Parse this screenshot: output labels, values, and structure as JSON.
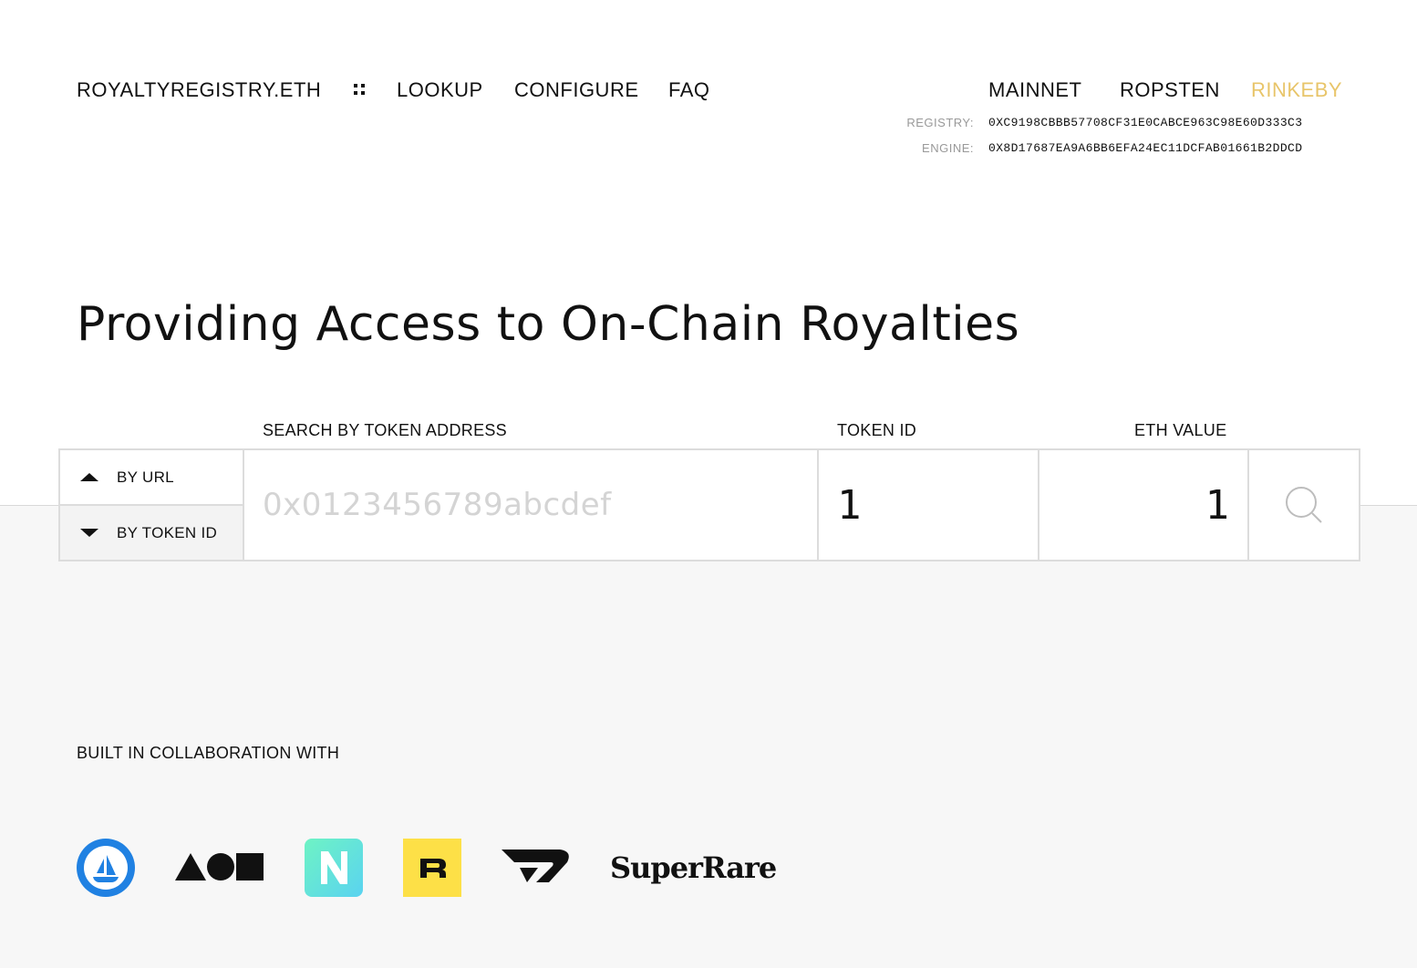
{
  "header": {
    "brand": "ROYALTYREGISTRY.ETH",
    "nav": [
      "LOOKUP",
      "CONFIGURE",
      "FAQ"
    ],
    "networks": [
      "MAINNET",
      "ROPSTEN",
      "RINKEBY"
    ],
    "active_network": "RINKEBY",
    "registry_label": "REGISTRY:",
    "registry_address": "0XC9198CBBB57708CF31E0CABCE963C98E60D333C3",
    "engine_label": "ENGINE:",
    "engine_address": "0X8D17687EA9A6BB6EFA24EC11DCFAB01661B2DDCD"
  },
  "hero": {
    "title": "Providing Access to On-Chain Royalties"
  },
  "search": {
    "address_label": "SEARCH BY TOKEN ADDRESS",
    "token_id_label": "TOKEN ID",
    "eth_value_label": "ETH VALUE",
    "mode_by_url": "BY URL",
    "mode_by_token_id": "BY TOKEN ID",
    "address_placeholder": "0x0123456789abcdef",
    "address_value": "",
    "token_id_value": "1",
    "eth_value": "1"
  },
  "collab": {
    "title": "BUILT IN COLLABORATION WITH",
    "partners": [
      "opensea-logo",
      "async-art-logo",
      "nifty-gateway-logo",
      "rarible-logo",
      "zora-logo",
      "SuperRare"
    ],
    "superrare_text": "SuperRare"
  },
  "colors": {
    "accent": "#e8c56a",
    "opensea_blue": "#2081e2",
    "rarible_yellow": "#fde047",
    "nifty_gradient_start": "#6ef3c4",
    "nifty_gradient_end": "#5ad3f0"
  }
}
